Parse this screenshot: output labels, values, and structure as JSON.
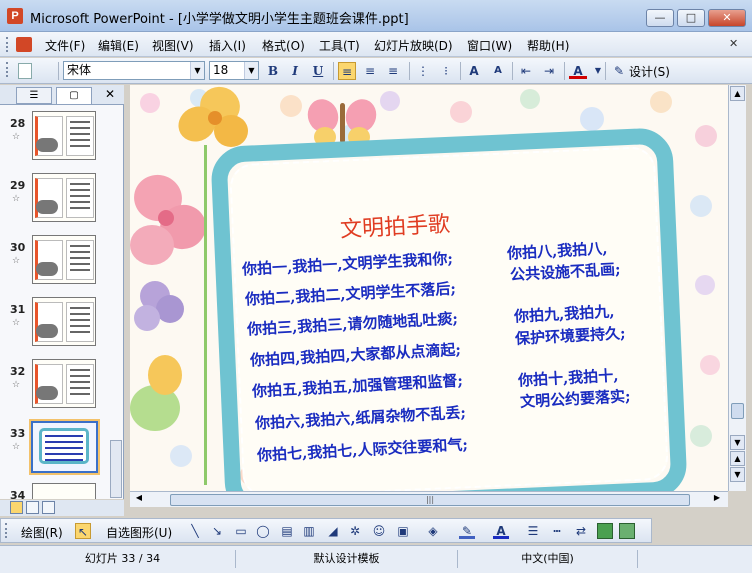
{
  "window": {
    "app_icon_letter": "P",
    "title": "Microsoft PowerPoint - [小学学做文明小学生主题班会课件.ppt]",
    "minimize_glyph": "—",
    "maximize_glyph": "□",
    "close_glyph": "✕"
  },
  "menubar": {
    "items": [
      "文件(F)",
      "编辑(E)",
      "视图(V)",
      "插入(I)",
      "格式(O)",
      "工具(T)",
      "幻灯片放映(D)",
      "窗口(W)",
      "帮助(H)"
    ],
    "doc_close_glyph": "✕"
  },
  "toolbar": {
    "font_name": "宋体",
    "font_size": "18",
    "bold": "B",
    "italic": "I",
    "underline": "U",
    "design_label": "设计(S)",
    "icons": [
      "new-icon",
      "bold-icon",
      "italic-icon",
      "underline-icon",
      "align-left-icon",
      "align-center-icon",
      "align-right-icon",
      "numbering-icon",
      "bullets-icon",
      "increase-font-icon",
      "decrease-font-icon",
      "decrease-indent-icon",
      "increase-indent-icon",
      "font-color-icon",
      "design-icon"
    ]
  },
  "slides_pane": {
    "tabs": [
      "outline-tab",
      "slides-tab"
    ],
    "close_glyph": "✕",
    "slides": [
      {
        "number": "28"
      },
      {
        "number": "29"
      },
      {
        "number": "30"
      },
      {
        "number": "31"
      },
      {
        "number": "32"
      },
      {
        "number": "33"
      },
      {
        "number": "34"
      }
    ],
    "selected": "33"
  },
  "slide": {
    "title": "文明拍手歌",
    "left_lines": [
      "你拍一,我拍一,文明学生我和你;",
      "你拍二,我拍二,文明学生不落后;",
      "你拍三,我拍三,请勿随地乱吐痰;",
      "你拍四,我拍四,大家都从点滴起;",
      "你拍五,我拍五,加强管理和监督;",
      "你拍六,我拍六,纸屑杂物不乱丢;",
      "你拍七,我拍七,人际交往要和气;"
    ],
    "right_lines": [
      "你拍八,我拍八,",
      "公共设施不乱画;",
      "你拍九,我拍九,",
      "保护环境要持久;",
      "你拍十,我拍十,",
      "文明公约要落实;"
    ]
  },
  "drawing_toolbar": {
    "draw_label": "绘图(R)",
    "autoshape_label": "自选图形(U)"
  },
  "statusbar": {
    "slide_info": "幻灯片 33 / 34",
    "design_template": "默认设计模板",
    "language": "中文(中国)"
  }
}
